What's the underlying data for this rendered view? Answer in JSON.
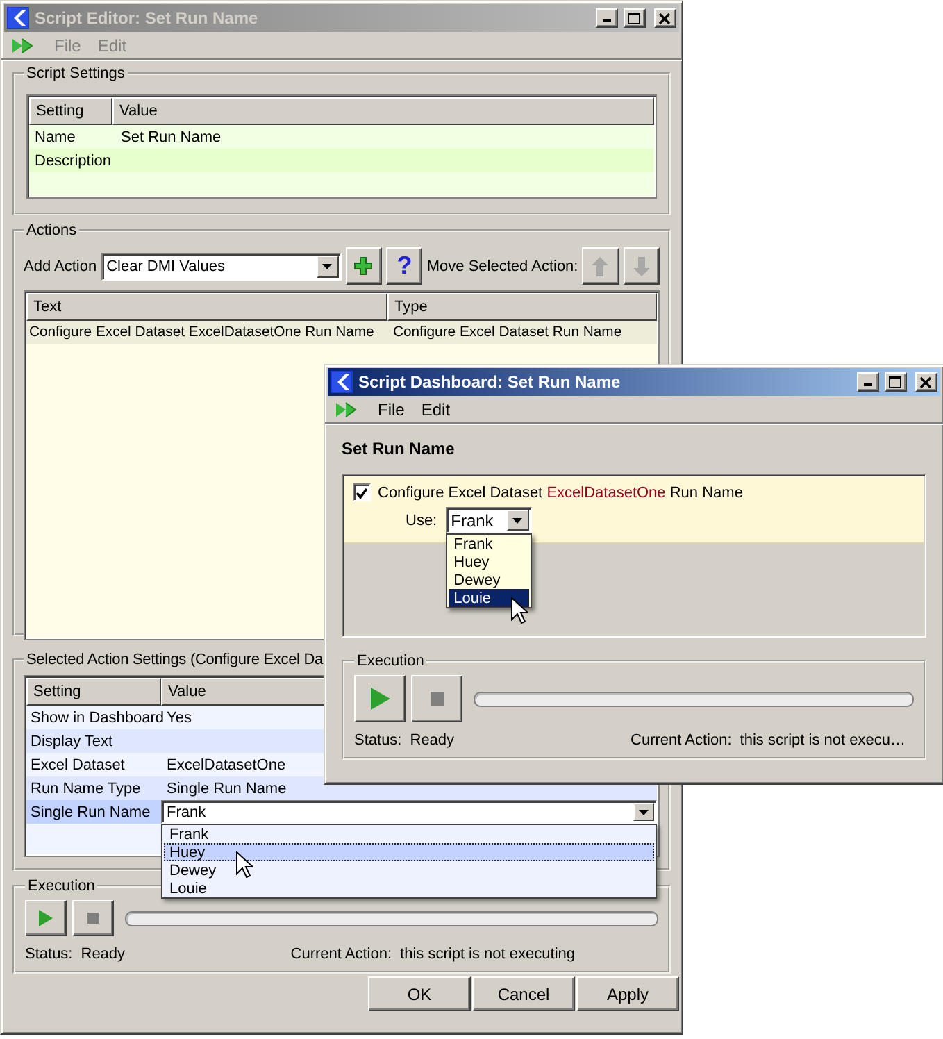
{
  "editor": {
    "title": "Script Editor: Set Run Name",
    "active": false,
    "menu": [
      {
        "label": "File",
        "disabled": true
      },
      {
        "label": "Edit",
        "disabled": true
      }
    ],
    "script_settings": {
      "legend": "Script Settings",
      "columns": [
        "Setting",
        "Value"
      ],
      "rows": [
        {
          "setting": "Name",
          "value": "Set Run Name"
        },
        {
          "setting": "Description"
        }
      ]
    },
    "actions": {
      "legend": "Actions",
      "add_action_label": "Add Action",
      "add_action_value": "Clear DMI Values",
      "help_button": "?",
      "move_label": "Move Selected Action:",
      "columns": [
        "Text",
        "Type"
      ],
      "rows": [
        {
          "text": "Configure Excel Dataset ExcelDatasetOne Run Name",
          "type": "Configure Excel Dataset Run Name"
        }
      ]
    },
    "selected_action_settings": {
      "legend": "Selected Action Settings (Configure Excel Da",
      "columns": [
        "Setting",
        "Value"
      ],
      "rows": [
        {
          "setting": "Show in Dashboard",
          "value": "Yes",
          "kind": "text",
          "selected": false
        },
        {
          "setting": "Display Text",
          "kind": "text",
          "selected": false
        },
        {
          "setting": "Excel Dataset",
          "value": "ExcelDatasetOne",
          "kind": "text",
          "selected": false
        },
        {
          "setting": "Run Name Type",
          "value": "Single Run Name",
          "kind": "text",
          "selected": false
        },
        {
          "setting": "Single Run Name",
          "value": "Frank",
          "kind": "dropdown",
          "selected": true
        }
      ],
      "options": [
        {
          "label": "Frank",
          "selected": false
        },
        {
          "label": "Huey",
          "selected": true
        },
        {
          "label": "Dewey",
          "selected": false
        },
        {
          "label": "Louie",
          "selected": false
        }
      ]
    },
    "execution": {
      "legend": "Execution",
      "status_label": "Status:",
      "status": "Ready",
      "current_action_label": "Current Action:",
      "current_action": "this script is not executing",
      "level": 0
    },
    "buttons": [
      "OK",
      "Cancel",
      "Apply"
    ]
  },
  "dashboard": {
    "title": "Script Dashboard: Set Run Name",
    "active": true,
    "menu": [
      {
        "label": "File",
        "disabled": false
      },
      {
        "label": "Edit",
        "disabled": false
      }
    ],
    "heading": "Set Run Name",
    "action": {
      "checked": true,
      "parts": [
        {
          "text": "Configure Excel Dataset",
          "kind": "plain"
        },
        {
          "text": "ExcelDatasetOne",
          "kind": "dataset"
        },
        {
          "text": "Run Name",
          "kind": "plain"
        }
      ],
      "use_label": "Use:",
      "use_value": "Frank",
      "options": [
        {
          "label": "Frank",
          "selected": false
        },
        {
          "label": "Huey",
          "selected": false
        },
        {
          "label": "Dewey",
          "selected": false
        },
        {
          "label": "Louie",
          "selected": true
        }
      ]
    },
    "execution": {
      "legend": "Execution",
      "status_label": "Status:",
      "status": "Ready",
      "current_action_label": "Current Action:",
      "current_action": "this script is not execu…",
      "level": 0
    }
  }
}
